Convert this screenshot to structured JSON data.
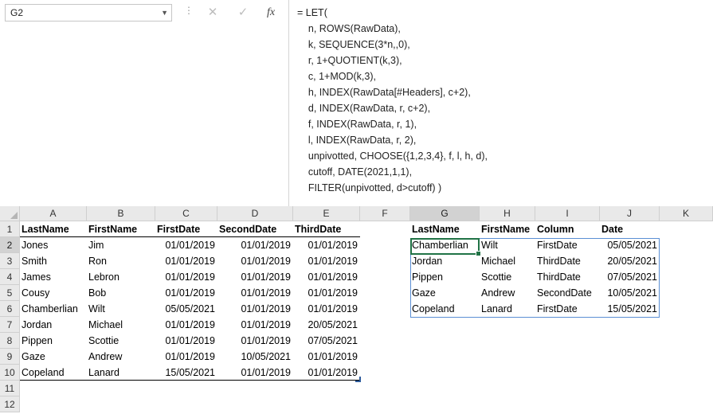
{
  "name_box": "G2",
  "formula_lines": [
    "= LET(",
    "    n, ROWS(RawData),",
    "    k, SEQUENCE(3*n,,0),",
    "    r, 1+QUOTIENT(k,3),",
    "    c, 1+MOD(k,3),",
    "    h, INDEX(RawData[#Headers], c+2),",
    "    d, INDEX(RawData, r, c+2),",
    "    f, INDEX(RawData, r, 1),",
    "    l, INDEX(RawData, r, 2),",
    "    unpivotted, CHOOSE({1,2,3,4}, f, l, h, d),",
    "    cutoff, DATE(2021,1,1),",
    "    FILTER(unpivotted, d>cutoff) )"
  ],
  "icons": {
    "cancel": "✕",
    "enter": "✓",
    "fx": "fx",
    "dropdown": "▼",
    "dots": "⋮"
  },
  "columns": [
    "A",
    "B",
    "C",
    "D",
    "E",
    "F",
    "G",
    "H",
    "I",
    "J",
    "K"
  ],
  "rows": [
    "1",
    "2",
    "3",
    "4",
    "5",
    "6",
    "7",
    "8",
    "9",
    "10",
    "11",
    "12"
  ],
  "raw_table": {
    "headers": [
      "LastName",
      "FirstName",
      "FirstDate",
      "SecondDate",
      "ThirdDate"
    ],
    "rows": [
      [
        "Jones",
        "Jim",
        "01/01/2019",
        "01/01/2019",
        "01/01/2019"
      ],
      [
        "Smith",
        "Ron",
        "01/01/2019",
        "01/01/2019",
        "01/01/2019"
      ],
      [
        "James",
        "Lebron",
        "01/01/2019",
        "01/01/2019",
        "01/01/2019"
      ],
      [
        "Cousy",
        "Bob",
        "01/01/2019",
        "01/01/2019",
        "01/01/2019"
      ],
      [
        "Chamberlian",
        "Wilt",
        "05/05/2021",
        "01/01/2019",
        "01/01/2019"
      ],
      [
        "Jordan",
        "Michael",
        "01/01/2019",
        "01/01/2019",
        "20/05/2021"
      ],
      [
        "Pippen",
        "Scottie",
        "01/01/2019",
        "01/01/2019",
        "07/05/2021"
      ],
      [
        "Gaze",
        "Andrew",
        "01/01/2019",
        "10/05/2021",
        "01/01/2019"
      ],
      [
        "Copeland",
        "Lanard",
        "15/05/2021",
        "01/01/2019",
        "01/01/2019"
      ]
    ]
  },
  "result_table": {
    "headers": [
      "LastName",
      "FirstName",
      "Column",
      "Date"
    ],
    "rows": [
      [
        "Chamberlian",
        "Wilt",
        "FirstDate",
        "05/05/2021"
      ],
      [
        "Jordan",
        "Michael",
        "ThirdDate",
        "20/05/2021"
      ],
      [
        "Pippen",
        "Scottie",
        "ThirdDate",
        "07/05/2021"
      ],
      [
        "Gaze",
        "Andrew",
        "SecondDate",
        "10/05/2021"
      ],
      [
        "Copeland",
        "Lanard",
        "FirstDate",
        "15/05/2021"
      ]
    ]
  },
  "colors": {
    "selection_border": "#217346",
    "spill_border": "#5b8fd4",
    "header_bg": "#e9e9e9"
  }
}
